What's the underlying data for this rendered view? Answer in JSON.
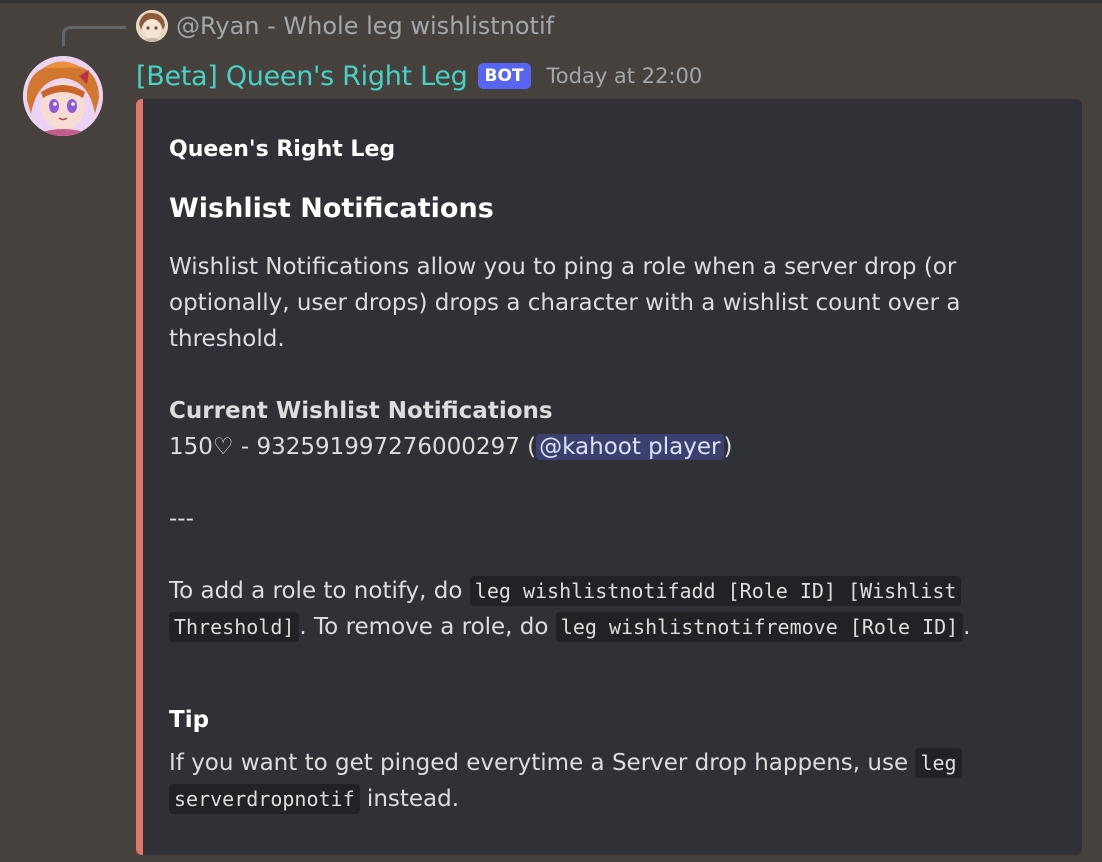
{
  "reply": {
    "text": "@Ryan - Whole leg wishlistnotif"
  },
  "message": {
    "username": "[Beta] Queen's Right Leg",
    "bot_tag": "BOT",
    "timestamp": "Today at 22:00"
  },
  "embed": {
    "accent_color": "#e2766d",
    "author": "Queen's Right Leg",
    "title": "Wishlist Notifications",
    "intro": "Wishlist Notifications allow you to ping a role when a server drop (or optionally, user drops) drops a character with a wishlist count over a threshold.",
    "current_heading": "Current Wishlist Notifications",
    "current_entry_prefix": "150♡ - 932591997276000297 (",
    "current_entry_mention": "@kahoot player",
    "current_entry_suffix": ")",
    "separator": "---",
    "instructions": {
      "part1": "To add a role to notify, do ",
      "code1": "leg wishlistnotifadd [Role ID] [Wishlist Threshold]",
      "part2": ". To remove a role, do ",
      "code2": "leg wishlistnotifremove [Role ID]",
      "part3": "."
    },
    "tip": {
      "name": "Tip",
      "text_before": "If you want to get pinged everytime a Server drop happens, use ",
      "code": "leg serverdropnotif",
      "text_after": " instead."
    }
  }
}
